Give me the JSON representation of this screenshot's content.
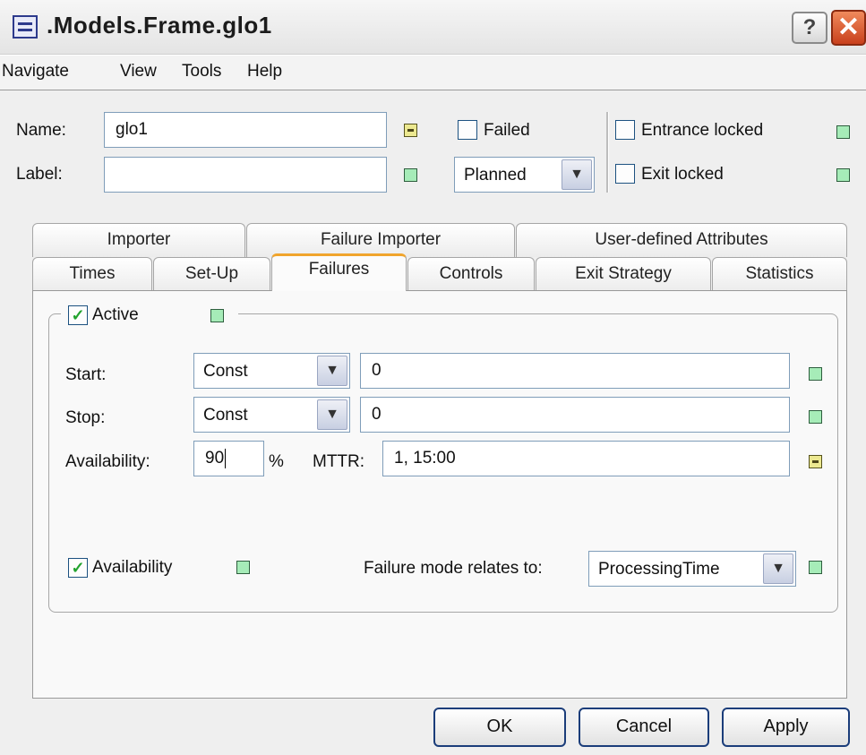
{
  "window": {
    "title": ".Models.Frame.glo1",
    "help_label": "?",
    "close_label": "✕"
  },
  "menu": [
    "Navigate",
    "View",
    "Tools",
    "Help"
  ],
  "header": {
    "name_label": "Name:",
    "name_value": "glo1",
    "label_label": "Label:",
    "label_value": "",
    "failed_label": "Failed",
    "failed_checked": false,
    "plan_value": "Planned",
    "entrance_locked_label": "Entrance locked",
    "exit_locked_label": "Exit locked"
  },
  "tabs_row1": [
    "Importer",
    "Failure Importer",
    "User-defined Attributes"
  ],
  "tabs_row2": [
    "Times",
    "Set-Up",
    "Failures",
    "Controls",
    "Exit Strategy",
    "Statistics"
  ],
  "active_tab": "Failures",
  "failures": {
    "active_label": "Active",
    "active_checked": true,
    "start_label": "Start:",
    "start_dist": "Const",
    "start_value": "0",
    "stop_label": "Stop:",
    "stop_dist": "Const",
    "stop_value": "0",
    "availability_label": "Availability:",
    "availability_value": "90",
    "percent_label": "%",
    "mttr_label": "MTTR:",
    "mttr_value": "1, 15:00",
    "availability_cb_label": "Availability",
    "availability_cb_checked": true,
    "failure_mode_label": "Failure mode relates to:",
    "failure_mode_value": "ProcessingTime"
  },
  "buttons": {
    "ok": "OK",
    "cancel": "Cancel",
    "apply": "Apply"
  },
  "colors": {
    "indicator_green": "#a6ecb8",
    "indicator_yellow": "#ece890",
    "close_red": "#c8401c",
    "tab_accent": "#f0a42c"
  }
}
